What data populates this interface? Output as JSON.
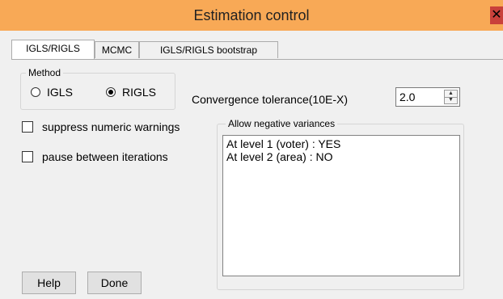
{
  "window": {
    "title": "Estimation control",
    "close_label": "✕"
  },
  "tabs": [
    {
      "label": "IGLS/RIGLS",
      "active": true
    },
    {
      "label": "MCMC",
      "active": false
    },
    {
      "label": "IGLS/RIGLS bootstrap",
      "active": false
    }
  ],
  "method": {
    "legend": "Method",
    "options": [
      {
        "label": "IGLS",
        "checked": false
      },
      {
        "label": "RIGLS",
        "checked": true
      }
    ]
  },
  "convergence": {
    "label": "Convergence tolerance(10E-X)",
    "value": "2.0"
  },
  "checkboxes": [
    {
      "label": "suppress numeric warnings",
      "checked": false
    },
    {
      "label": "pause between iterations",
      "checked": false
    }
  ],
  "negative_variances": {
    "legend": "Allow negative variances",
    "items": [
      "At level 1 (voter) :  YES",
      "At level 2 (area) :  NO"
    ]
  },
  "buttons": {
    "help": "Help",
    "done": "Done"
  }
}
